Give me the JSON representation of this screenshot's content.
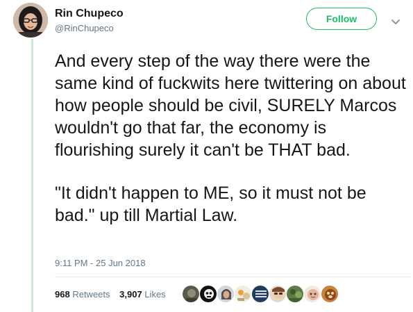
{
  "tweet": {
    "display_name": "Rin Chupeco",
    "handle": "@RinChupeco",
    "follow_label": "Follow",
    "paragraphs": [
      "And every step of the way there were the same kind of fuckwits here twittering on about how people should be civil, SURELY Marcos wouldn't go that far, the economy is flourishing surely it can't be THAT bad.",
      "\"It didn't happen to ME, so it must not be bad.\" up till Martial Law."
    ],
    "timestamp": "9:11 PM - 25 Jun 2018",
    "stats": {
      "retweets_count": "968",
      "retweets_label": "Retweets",
      "likes_count": "3,907",
      "likes_label": "Likes"
    },
    "liker_avatars": [
      "avatar-1",
      "avatar-2",
      "avatar-3",
      "avatar-4",
      "avatar-5",
      "avatar-6",
      "avatar-7",
      "avatar-8",
      "avatar-9"
    ]
  },
  "colors": {
    "accent": "#17bf63",
    "secondary_text": "#657786",
    "primary_text": "#14171a",
    "thread_line": "#cde8d5"
  }
}
